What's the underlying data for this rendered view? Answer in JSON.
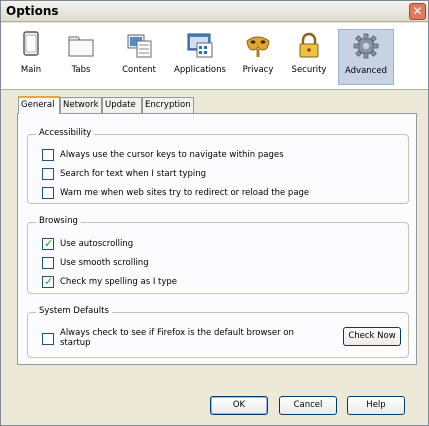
{
  "window": {
    "title": "Options",
    "close_label": "✕"
  },
  "toolbar": {
    "panes": [
      {
        "label": "Main",
        "icon": "main-window-icon"
      },
      {
        "label": "Tabs",
        "icon": "tabs-folder-icon"
      },
      {
        "label": "Content",
        "icon": "content-icon"
      },
      {
        "label": "Applications",
        "icon": "applications-icon"
      },
      {
        "label": "Privacy",
        "icon": "privacy-mask-icon"
      },
      {
        "label": "Security",
        "icon": "security-lock-icon"
      },
      {
        "label": "Advanced",
        "icon": "advanced-gear-icon"
      }
    ],
    "selected": "Advanced"
  },
  "tabs": [
    "General",
    "Network",
    "Update",
    "Encryption"
  ],
  "selected_tab": "General",
  "groups": {
    "accessibility": {
      "title": "Accessibility",
      "items": [
        {
          "label": "Always use the cursor keys to navigate within pages",
          "checked": false
        },
        {
          "label": "Search for text when I start typing",
          "checked": false
        },
        {
          "label": "Warn me when web sites try to redirect or reload the page",
          "checked": false
        }
      ]
    },
    "browsing": {
      "title": "Browsing",
      "items": [
        {
          "label": "Use autoscrolling",
          "checked": true
        },
        {
          "label": "Use smooth scrolling",
          "checked": false
        },
        {
          "label": "Check my spelling as I type",
          "checked": true
        }
      ]
    },
    "system_defaults": {
      "title": "System Defaults",
      "check_label_line1": "Always check to see if Firefox is the default browser on",
      "check_label_line2": "startup",
      "checked": false,
      "check_now_label": "Check Now"
    }
  },
  "footer": {
    "ok_label": "OK",
    "cancel_label": "Cancel",
    "help_label": "Help"
  },
  "colors": {
    "active_tab_accent": "#e6a73b",
    "selected_pane_bg": "#c7d2e4",
    "check_green": "#21a121"
  }
}
